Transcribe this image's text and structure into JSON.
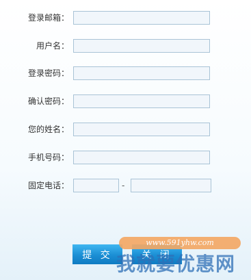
{
  "form": {
    "fields": [
      {
        "label": "登录邮箱：",
        "value": "",
        "placeholder": ""
      },
      {
        "label": "用户名：",
        "value": "",
        "placeholder": ""
      },
      {
        "label": "登录密码：",
        "value": "",
        "placeholder": ""
      },
      {
        "label": "确认密码：",
        "value": "",
        "placeholder": ""
      },
      {
        "label": "您的姓名：",
        "value": "",
        "placeholder": ""
      },
      {
        "label": "手机号码：",
        "value": "",
        "placeholder": ""
      }
    ],
    "phone": {
      "label": "固定电话：",
      "separator": "-",
      "area_value": "",
      "number_value": ""
    }
  },
  "buttons": {
    "submit_label": "提 交",
    "close_label": "关 闭"
  },
  "watermark": {
    "url": "www.591yhw.com",
    "text": "我就要优惠网"
  }
}
